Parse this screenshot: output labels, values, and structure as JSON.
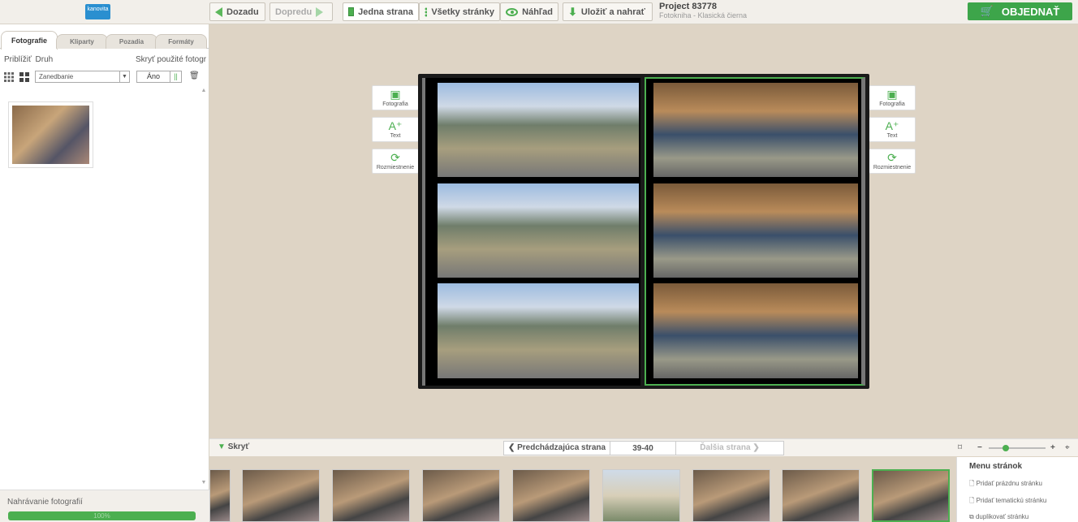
{
  "topbar": {
    "logo_text": "kanovita",
    "back": "Dozadu",
    "forward": "Dopredu",
    "single_page": "Jedna strana",
    "all_pages": "Všetky stránky",
    "preview": "Náhľad",
    "save": "Uložiť a nahrať",
    "project_title": "Project 83778",
    "project_sub": "Fotokniha - Klasická čierna",
    "order": "OBJEDNAŤ"
  },
  "left": {
    "tabs": [
      "Fotografie",
      "Kliparty",
      "Pozadia",
      "Formáty"
    ],
    "zoom_label": "Priblížiť",
    "type_label": "Druh",
    "hide_used_label": "Skryť použité fotogr",
    "select_value": "Zanedbanie",
    "toggle_yes": "Áno",
    "upload_label": "Nahrávanie fotografií",
    "upload_percent": "100%"
  },
  "editor": {
    "side_buttons": [
      "Fotografia",
      "Text",
      "Rozmiestnenie"
    ]
  },
  "nav": {
    "hide": "Skryť",
    "prev": "Predchádzajúca strana",
    "page": "39-40",
    "next": "Ďalšia strana"
  },
  "page_menu": {
    "title": "Menu stránok",
    "items": [
      "Pridať prázdnu stránku",
      "Pridať tematickú stránku",
      "duplikovať stránku"
    ]
  },
  "colors": {
    "accent": "#4caf50",
    "order_bg": "#3da54a",
    "canvas_bg": "#ded4c5"
  }
}
